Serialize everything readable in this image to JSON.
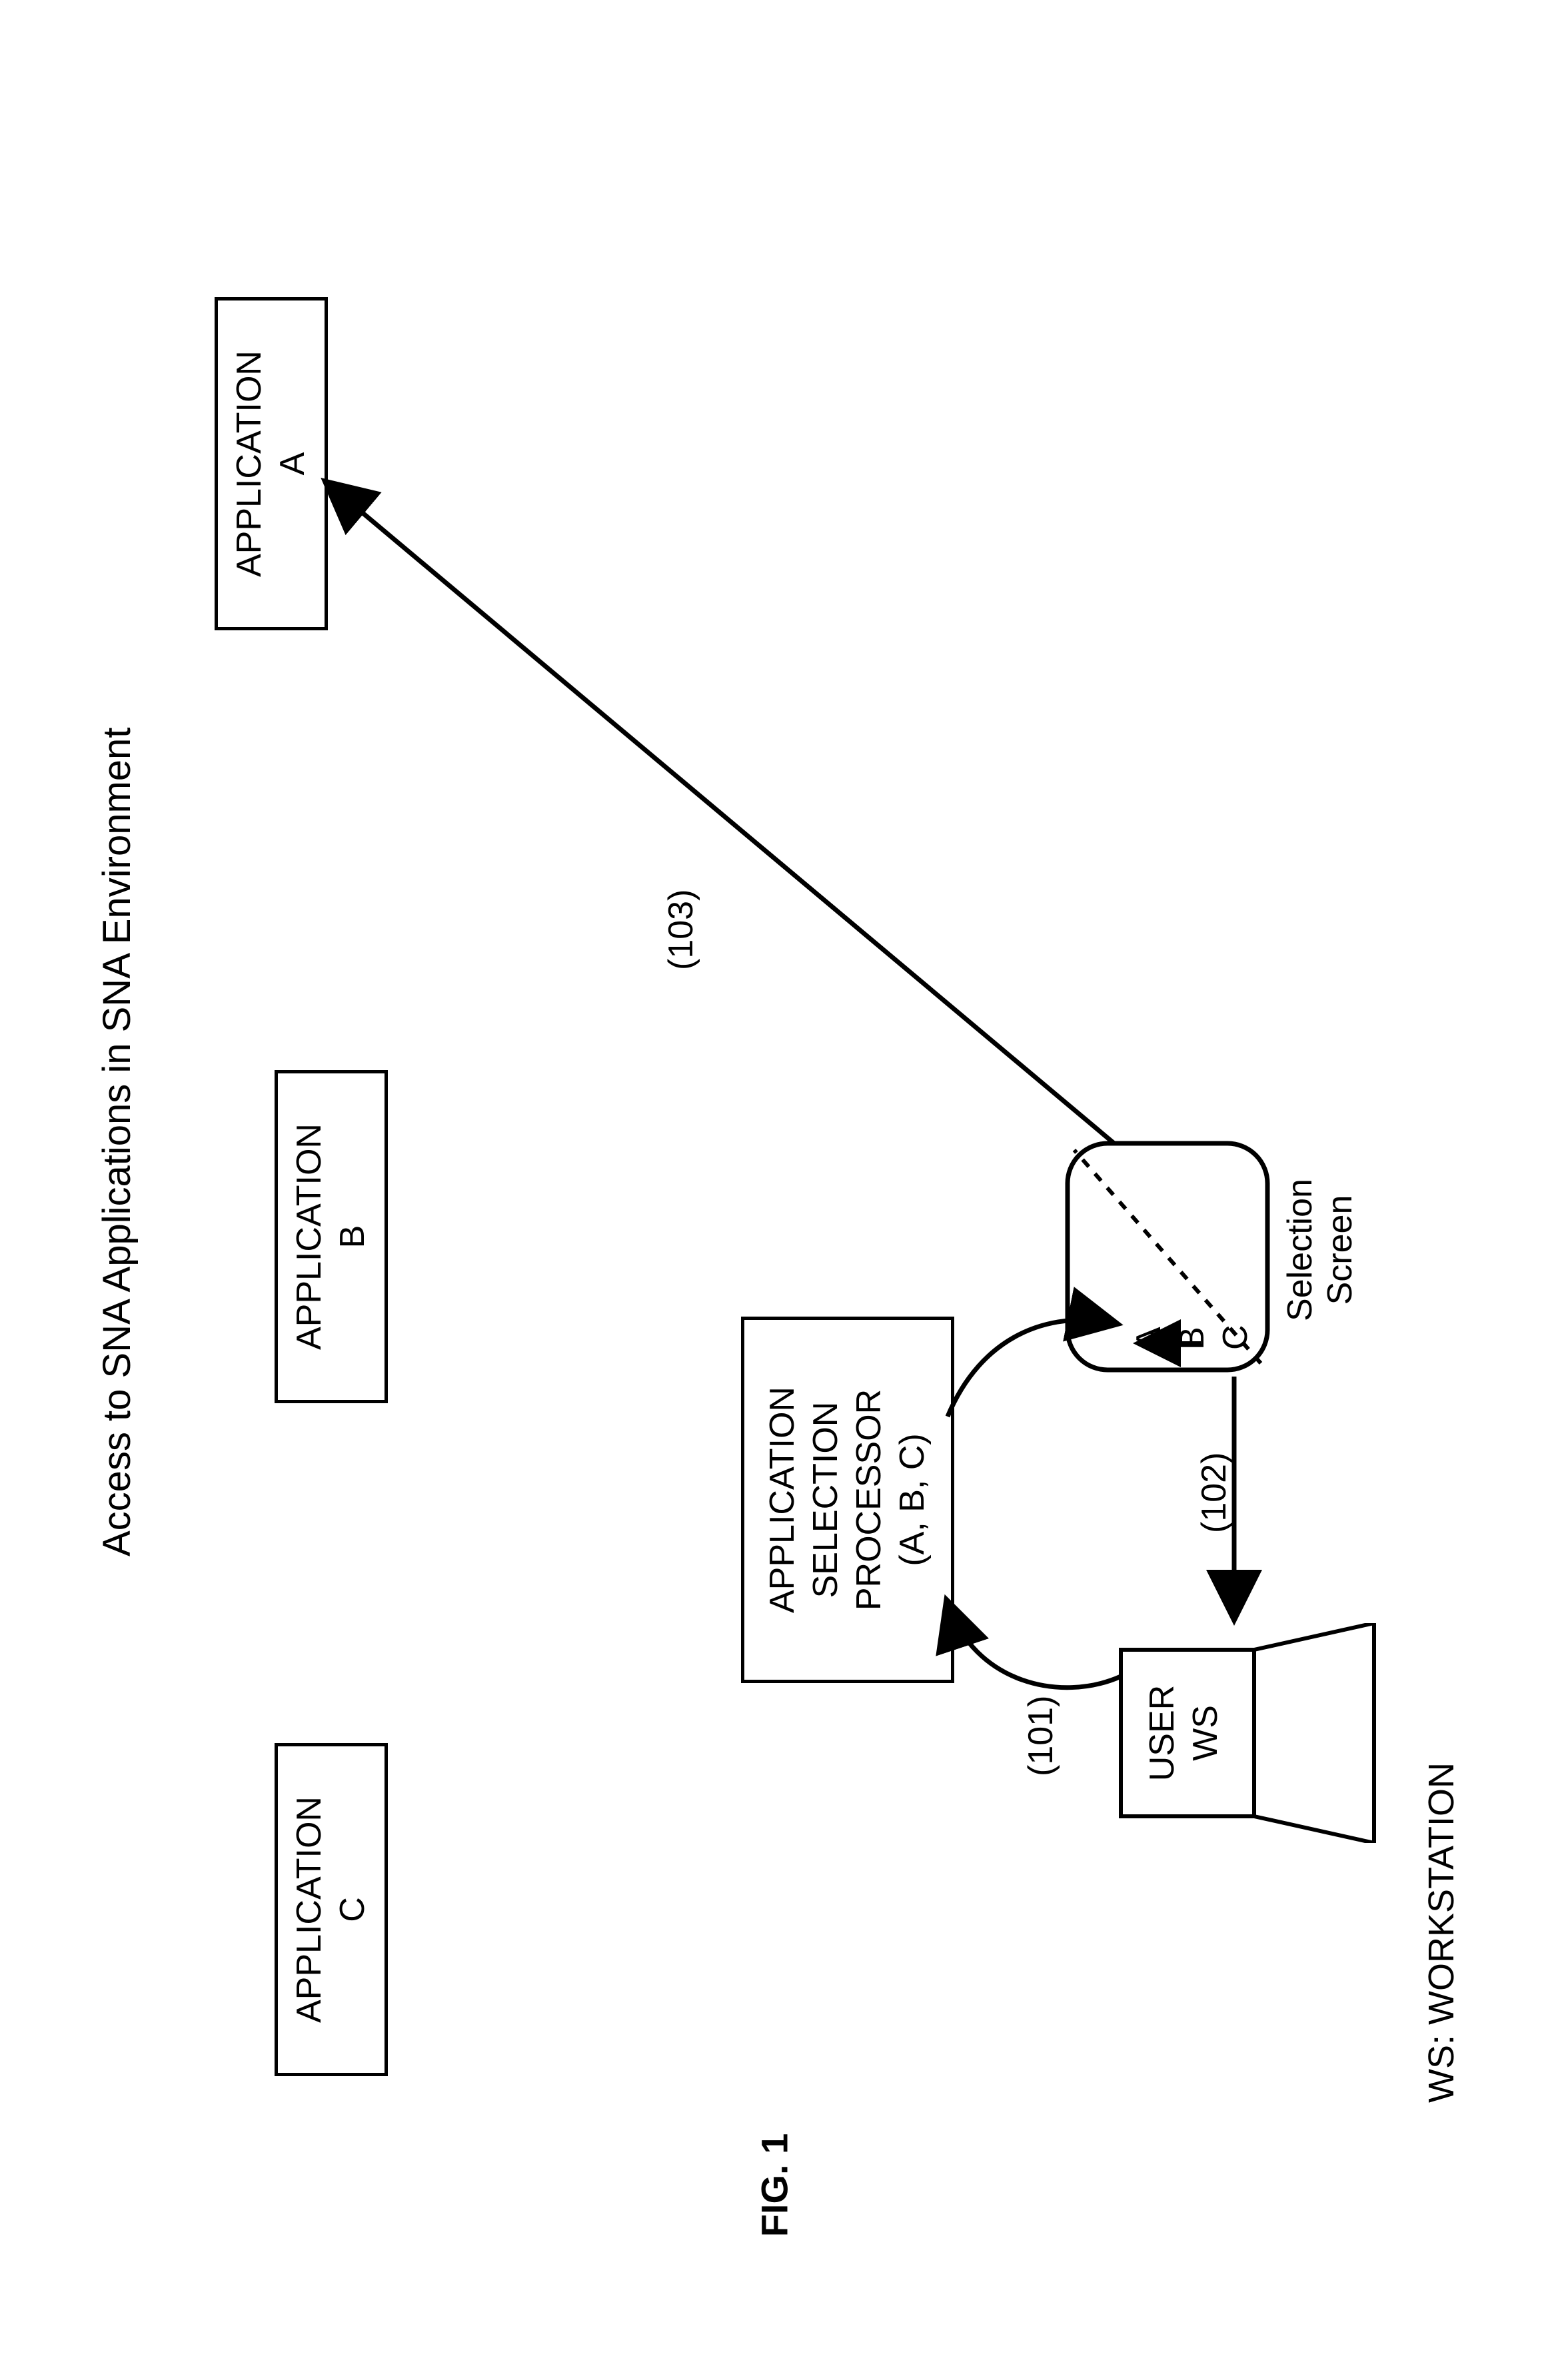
{
  "figure_label": "FIG. 1",
  "title": "Access to SNA Applications in SNA Environment",
  "footer_note": "WS: WORKSTATION",
  "apps": {
    "c": {
      "line1": "APPLICATION",
      "line2": "C"
    },
    "b": {
      "line1": "APPLICATION",
      "line2": "B"
    },
    "a": {
      "line1": "APPLICATION",
      "line2": "A"
    }
  },
  "selector": {
    "line1": "APPLICATION",
    "line2": "SELECTION",
    "line3": "PROCESSOR",
    "line4": "(A, B, C)"
  },
  "workstation": {
    "line1": "USER",
    "line2": "WS"
  },
  "selection_screen": {
    "items": [
      "A",
      "B",
      "C"
    ],
    "caption1": "Selection",
    "caption2": "Screen"
  },
  "arrows": {
    "a101": "(101)",
    "a102": "(102)",
    "a103": "(103)"
  }
}
